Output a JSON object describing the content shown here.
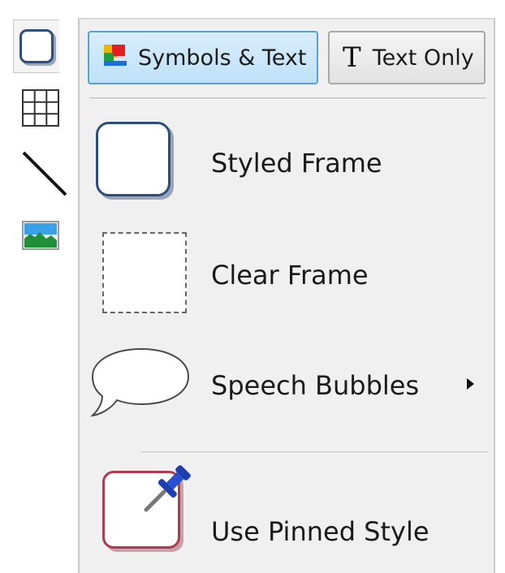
{
  "tabs": {
    "symbols_text": "Symbols & Text",
    "text_only": "Text Only",
    "text_only_glyph": "T"
  },
  "items": [
    {
      "label": "Styled Frame",
      "icon": "styled-frame-icon"
    },
    {
      "label": "Clear Frame",
      "icon": "clear-frame-icon"
    },
    {
      "label": "Speech Bubbles",
      "icon": "speech-bubble-icon",
      "has_submenu": true
    },
    {
      "label": "Use Pinned Style",
      "icon": "pinned-style-icon"
    }
  ],
  "toolbar": {
    "tools": [
      "frame-tool-icon",
      "table-tool-icon",
      "line-tool-icon",
      "image-tool-icon"
    ]
  },
  "colors": {
    "active_tab_bg": "#c9e6fa",
    "active_tab_border": "#56a1d6",
    "frame_border": "#2b4e7a",
    "pinned_border": "#b23a4e",
    "pin_blue": "#1f3fb0"
  }
}
